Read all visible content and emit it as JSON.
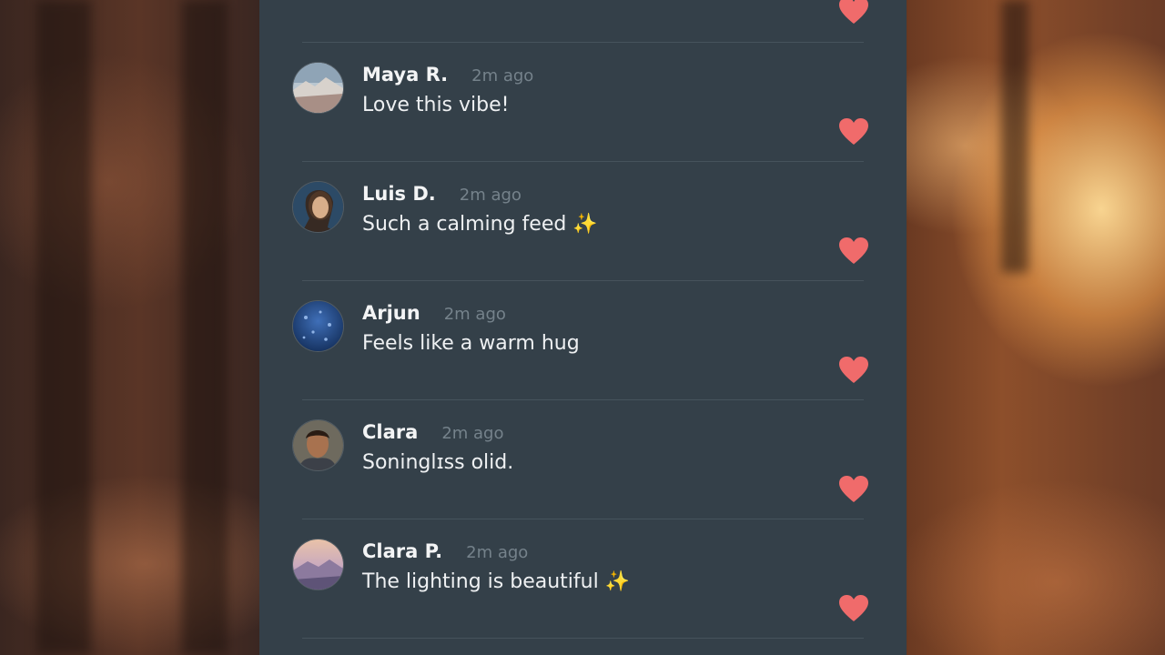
{
  "colors": {
    "panel": "#344049",
    "heart": "#f06b6b",
    "name": "#f3f4f5",
    "timestamp": "#75828b"
  },
  "comments": [
    {
      "name": "Maya R.",
      "time": "2m ago",
      "text": "Love this vibe!",
      "avatar": "mountain-landscape-avatar"
    },
    {
      "name": "Luis D.",
      "time": "2m ago",
      "text": "Such a calming feed ✨",
      "avatar": "person-portrait-avatar"
    },
    {
      "name": "Arjun",
      "time": "2m ago",
      "text": "Feels like a warm hug",
      "avatar": "blue-texture-avatar"
    },
    {
      "name": "Clara",
      "time": "2m ago",
      "text": "Soningl͏ɪss olid.",
      "avatar": "man-portrait-avatar"
    },
    {
      "name": "Clara P.",
      "time": "2m ago",
      "text": "The lighting is beautiful ✨",
      "avatar": "sunset-landscape-avatar"
    }
  ]
}
